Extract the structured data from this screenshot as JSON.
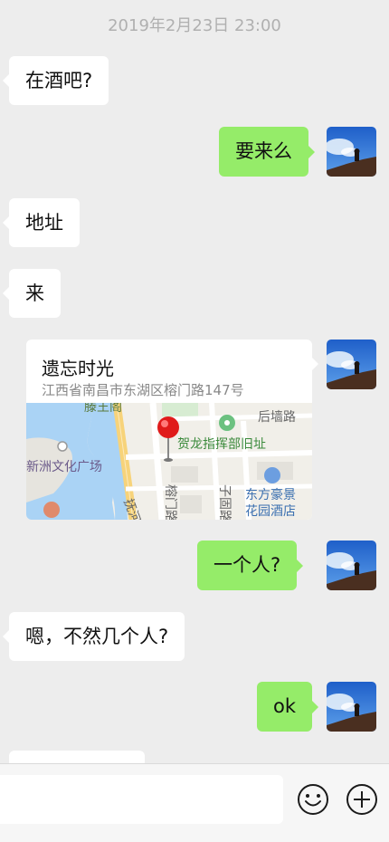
{
  "chat": {
    "timestamp": "2019年2月23日 23:00",
    "messages": [
      {
        "side": "left",
        "text": "在酒吧?"
      },
      {
        "side": "right",
        "text": "要来么"
      },
      {
        "side": "left",
        "text": "地址"
      },
      {
        "side": "left",
        "text": "来"
      },
      {
        "side": "right",
        "type": "location"
      },
      {
        "side": "right",
        "text": "一个人?"
      },
      {
        "side": "left",
        "text": "嗯，不然几个人?"
      },
      {
        "side": "right",
        "text": "ok"
      }
    ],
    "location": {
      "name": "遗忘时光",
      "address": "江西省南昌市东湖区榕门路147号",
      "map_labels": {
        "l1": "滕王阁",
        "l2": "后墙路",
        "l3": "贺龙指挥部旧址",
        "l4": "新洲文化广场",
        "l5": "抚河北",
        "l6": "榕门路",
        "l7": "子固路",
        "l8": "东方豪景",
        "l9": "花园酒店"
      }
    }
  },
  "input": {
    "value": "",
    "placeholder": ""
  },
  "icons": {
    "emoji": "emoji-icon",
    "add": "plus-circle-icon"
  },
  "colors": {
    "background": "#ededed",
    "sent_bubble": "#95ec69",
    "received_bubble": "#ffffff",
    "timestamp": "#b0b0b0"
  }
}
